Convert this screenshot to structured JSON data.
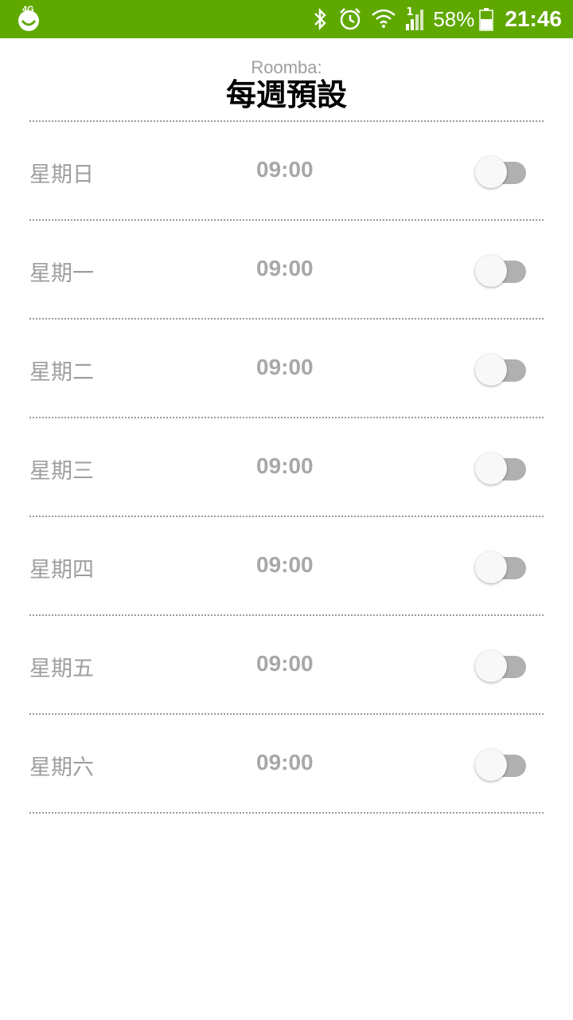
{
  "status_bar": {
    "carrier_label": "4G",
    "battery_pct": "58%",
    "time": "21:46",
    "signal_label": "1",
    "color": "#5fa800"
  },
  "header": {
    "subtitle": "Roomba:",
    "title": "每週預設"
  },
  "schedule": [
    {
      "day": "星期日",
      "time": "09:00",
      "enabled": false
    },
    {
      "day": "星期一",
      "time": "09:00",
      "enabled": false
    },
    {
      "day": "星期二",
      "time": "09:00",
      "enabled": false
    },
    {
      "day": "星期三",
      "time": "09:00",
      "enabled": false
    },
    {
      "day": "星期四",
      "time": "09:00",
      "enabled": false
    },
    {
      "day": "星期五",
      "time": "09:00",
      "enabled": false
    },
    {
      "day": "星期六",
      "time": "09:00",
      "enabled": false
    }
  ]
}
